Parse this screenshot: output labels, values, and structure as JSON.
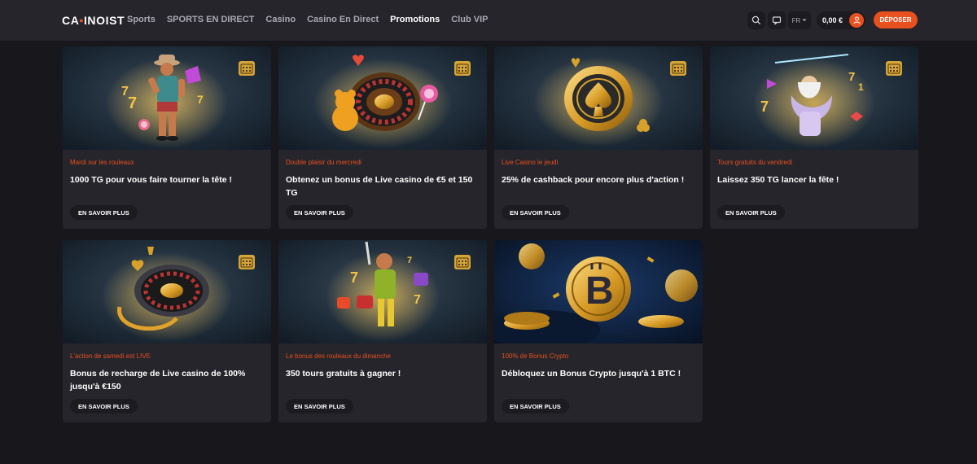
{
  "header": {
    "logo": {
      "part1": "CA",
      "part2": "•",
      "part3": "INOIST"
    },
    "nav": [
      {
        "label": "Sports",
        "active": false
      },
      {
        "label": "SPORTS EN DIRECT",
        "active": false
      },
      {
        "label": "Casino",
        "active": false
      },
      {
        "label": "Casino En Direct",
        "active": false
      },
      {
        "label": "Promotions",
        "active": true
      },
      {
        "label": "Club VIP",
        "active": false
      }
    ],
    "language": "FR",
    "balance": "0,00 €",
    "deposit_label": "DÉPOSER",
    "icons": {
      "search": "search-icon",
      "chat": "chat-icon",
      "user": "user-icon"
    }
  },
  "accent_color": "#e8501f",
  "promotions": [
    {
      "tag": "Mardi sur les rouleaux",
      "title": "1000 TG pour vous faire tourner la tête !",
      "button": "EN SAVOIR PLUS",
      "image": "cowboy-character"
    },
    {
      "tag": "Double plaisir du mercredi",
      "title": "Obtenez un bonus de Live casino de €5 et 150 TG",
      "button": "EN SAVOIR PLUS",
      "image": "roulette-wheel"
    },
    {
      "tag": "Live Casino le jeudi",
      "title": "25% de cashback pour encore plus d'action !",
      "button": "EN SAVOIR PLUS",
      "image": "spade-chip"
    },
    {
      "tag": "Tours gratuits du vendredi",
      "title": "Laissez 350 TG lancer la fête !",
      "button": "EN SAVOIR PLUS",
      "image": "zeus-character"
    },
    {
      "tag": "L'action de samedi est LIVE",
      "title": "Bonus de recharge de Live casino de 100% jusqu'à €150",
      "button": "EN SAVOIR PLUS",
      "image": "roulette-wheel"
    },
    {
      "tag": "Le bonus des rouleaux du dimanche",
      "title": "350 tours gratuits à gagner !",
      "button": "EN SAVOIR PLUS",
      "image": "miner-character"
    },
    {
      "tag": "100% de Bonus Crypto",
      "title": "Débloquez un Bonus Crypto jusqu'à 1 BTC !",
      "button": "EN SAVOIR PLUS",
      "image": "bitcoin-coins"
    }
  ]
}
